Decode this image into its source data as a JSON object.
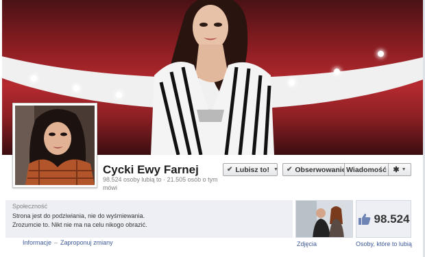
{
  "page": {
    "name": "Cycki Ewy Farnej",
    "stats": "98.524 osoby lubią to · 21.505 osób o tym mówi"
  },
  "buttons": {
    "like": "Lubisz to!",
    "follow": "Obserwowanie",
    "message": "Wiadomość"
  },
  "about": {
    "heading": "Społeczność",
    "line1": "Strona jest do podziwiania, nie do wyśmiewania.",
    "line2": "Zrozumcie to. Nikt nie ma na celu nikogo obrazić."
  },
  "tiles": {
    "photos_label": "Zdjęcia",
    "likes_count": "98.524",
    "likes_label": "Osoby, które to lubią"
  },
  "links": {
    "info": "Informacje",
    "suggest": "Zaproponuj zmiany"
  },
  "icons": {
    "like": "thumbs-up-icon",
    "check": "check-icon",
    "gear": "gear-icon",
    "caret": "caret-down-icon"
  }
}
